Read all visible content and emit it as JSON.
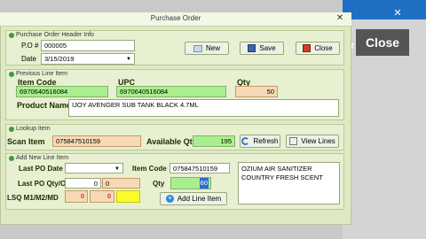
{
  "window": {
    "title": "Purchase Order",
    "close_glyph": "✕"
  },
  "background_app": {
    "close_label": "Close",
    "window_close_glyph": "✕",
    "left_glyph": "r"
  },
  "header": {
    "section_title": "Purchase Order Header Info",
    "po_label": "P.O #",
    "po_value": "000005",
    "date_label": "Date",
    "date_value": "3/15/2019",
    "new_label": "New",
    "save_label": "Save",
    "close_label": "Close"
  },
  "previous_line": {
    "section_title": "Previous Line Item",
    "item_code_label": "Item Code",
    "item_code_value": "6970640516084",
    "upc_label": "UPC",
    "upc_value": "6970640516084",
    "qty_label": "Qty",
    "qty_value": "50",
    "product_name_label": "Product Name",
    "product_name_value": "IJOY AVENGER SUB TANK BLACK 4.7ML"
  },
  "lookup": {
    "section_title": "Lookup Item",
    "scan_label": "Scan Item",
    "scan_value": "075847510159",
    "available_label": "Available Qty",
    "available_value": "195",
    "refresh_label": "Refresh",
    "view_lines_label": "View Lines"
  },
  "add_line": {
    "section_title": "Add New Line Item",
    "last_po_date_label": "Last PO Date",
    "last_po_date_value": "",
    "item_code_label": "Item Code",
    "item_code_value": "075847510159",
    "last_po_qty_label": "Last PO Qty/OPO",
    "last_po_qty_value": "0",
    "opo_value": "0",
    "qty_label": "Qty",
    "qty_value": "60",
    "lsq_label": "LSQ M1/M2/MD",
    "m1_value": "0",
    "m2_value": "0",
    "md_value": "",
    "description": "OZIUM AIR SANITIZER COUNTRY FRESH SCENT",
    "add_button_label": "Add Line Item"
  },
  "colors": {
    "green_field": "#a9ef8e",
    "orange_field": "#f8d9b5",
    "yellow_field": "#fbfb2a",
    "dialog_bg": "#dfe9c4"
  }
}
